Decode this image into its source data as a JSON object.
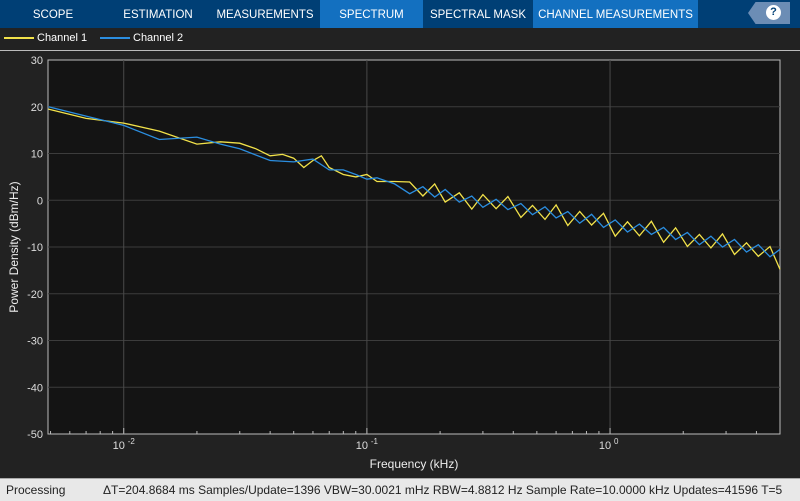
{
  "tabs": [
    "SCOPE",
    "ESTIMATION",
    "MEASUREMENTS",
    "SPECTRUM",
    "SPECTRAL MASK",
    "CHANNEL MEASUREMENTS"
  ],
  "active_tab": "SPECTRUM",
  "help_icon": "question-icon",
  "status": {
    "state": "Processing",
    "info": "ΔT=204.8684 ms  Samples/Update=1396  VBW=30.0021 mHz  RBW=4.8812 Hz  Sample Rate=10.0000 kHz  Updates=41596  T=5"
  },
  "chart_data": {
    "type": "line",
    "xlabel": "Frequency (kHz)",
    "ylabel": "Power Density (dBm/Hz)",
    "xscale": "log",
    "xlim": [
      0.0048812,
      5
    ],
    "ylim": [
      -50,
      30
    ],
    "xticks": [
      0.01,
      0.1,
      1
    ],
    "xtick_labels": [
      "10",
      "10",
      "10"
    ],
    "xtick_exponents": [
      "-2",
      "-1",
      "0"
    ],
    "yticks": [
      -50,
      -40,
      -30,
      -20,
      -10,
      0,
      10,
      20,
      30
    ],
    "grid": true,
    "legend": "top",
    "background": "#141414",
    "series": [
      {
        "name": "Channel 1",
        "color": "#f2e24a",
        "x": [
          0.0049,
          0.007,
          0.01,
          0.014,
          0.02,
          0.025,
          0.03,
          0.035,
          0.04,
          0.045,
          0.05,
          0.055,
          0.06,
          0.065,
          0.07,
          0.08,
          0.09,
          0.1,
          0.11,
          0.13,
          0.15,
          0.17,
          0.19,
          0.21,
          0.24,
          0.27,
          0.3,
          0.34,
          0.38,
          0.43,
          0.48,
          0.54,
          0.6,
          0.67,
          0.75,
          0.84,
          0.94,
          1.05,
          1.18,
          1.32,
          1.48,
          1.66,
          1.86,
          2.08,
          2.33,
          2.6,
          2.9,
          3.25,
          3.64,
          4.07,
          4.55,
          5
        ],
        "y": [
          19.5,
          17.5,
          16.5,
          14.8,
          12,
          12.5,
          12.2,
          11,
          9.5,
          9.8,
          9,
          7,
          8.5,
          9.5,
          7,
          5.5,
          5,
          5.5,
          4,
          4,
          3.9,
          0.9,
          3.5,
          -0.4,
          1.6,
          -1.9,
          1.2,
          -1.8,
          0.8,
          -3.7,
          -1.1,
          -4.1,
          -1,
          -5.4,
          -2.4,
          -5.3,
          -2.8,
          -7.7,
          -4.6,
          -7.6,
          -4.5,
          -9,
          -5.9,
          -9.9,
          -7.3,
          -10.2,
          -7.2,
          -11.6,
          -9.1,
          -12,
          -9.9,
          -14.8
        ]
      },
      {
        "name": "Channel 2",
        "color": "#2b8ee0",
        "x": [
          0.0049,
          0.007,
          0.01,
          0.014,
          0.02,
          0.025,
          0.03,
          0.04,
          0.05,
          0.06,
          0.07,
          0.08,
          0.09,
          0.1,
          0.11,
          0.13,
          0.15,
          0.17,
          0.19,
          0.21,
          0.24,
          0.27,
          0.3,
          0.34,
          0.38,
          0.43,
          0.48,
          0.54,
          0.6,
          0.67,
          0.75,
          0.84,
          0.94,
          1.05,
          1.18,
          1.32,
          1.48,
          1.66,
          1.86,
          2.08,
          2.33,
          2.6,
          2.9,
          3.25,
          3.64,
          4.07,
          4.55,
          5
        ],
        "y": [
          20,
          18,
          16,
          13,
          13.5,
          12,
          11,
          8.5,
          8.2,
          8.8,
          6.5,
          6.5,
          5.5,
          4.5,
          4.8,
          3.5,
          1.4,
          2.9,
          0.7,
          2.3,
          -0.4,
          0.9,
          -1.5,
          0.2,
          -2,
          -0.7,
          -3.1,
          -1.4,
          -3.8,
          -2.4,
          -4.9,
          -3,
          -5.8,
          -4.2,
          -6.8,
          -5.1,
          -7.3,
          -5.8,
          -8.4,
          -6.9,
          -9.5,
          -7.7,
          -10,
          -8.4,
          -11.1,
          -9.5,
          -12.1,
          -10.5
        ]
      }
    ]
  }
}
